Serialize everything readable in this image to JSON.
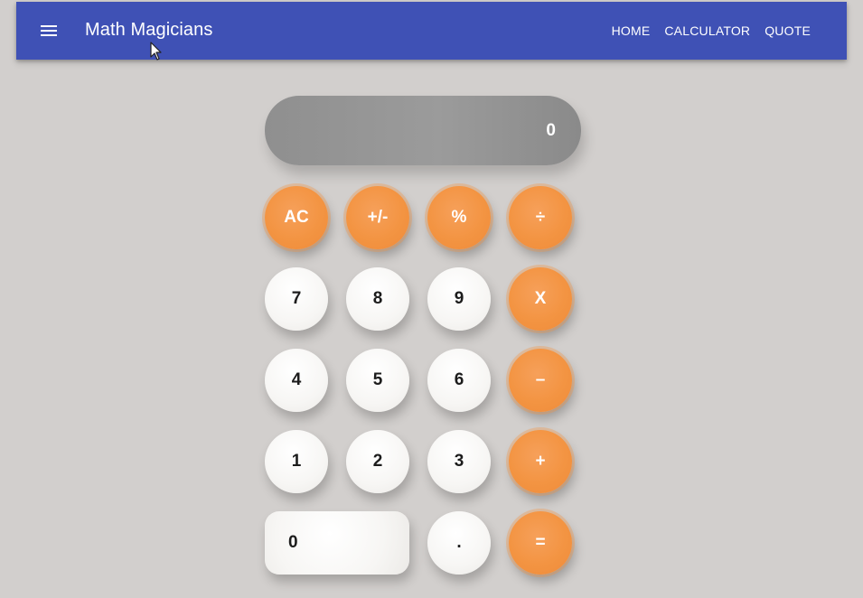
{
  "appbar": {
    "title": "Math Magicians",
    "nav": [
      "HOME",
      "CALCULATOR",
      "QUOTE"
    ]
  },
  "calculator": {
    "display": "0",
    "keys": {
      "ac": "AC",
      "sign": "+/-",
      "percent": "%",
      "divide": "÷",
      "seven": "7",
      "eight": "8",
      "nine": "9",
      "multiply": "X",
      "four": "4",
      "five": "5",
      "six": "6",
      "subtract": "–",
      "one": "1",
      "two": "2",
      "three": "3",
      "add": "+",
      "zero": "0",
      "dot": ".",
      "equals": "="
    }
  },
  "colors": {
    "appbar": "#3f51b5",
    "operator_key": "#f39442",
    "number_key": "#f7f6f4",
    "display": "#969696",
    "background": "#d2cfcd"
  },
  "icons": {
    "menu": "menu-icon",
    "pointer": "mouse-pointer-icon"
  }
}
